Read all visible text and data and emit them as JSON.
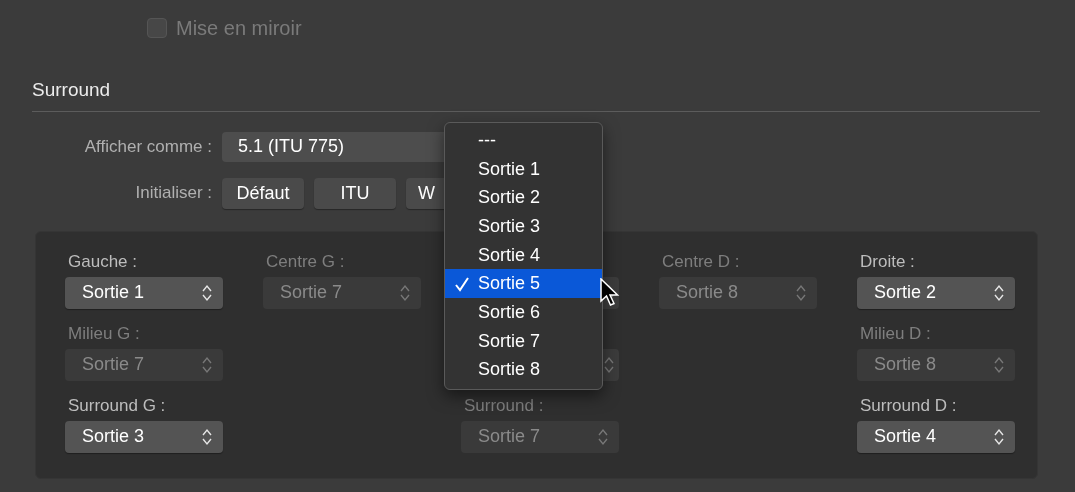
{
  "mirror": {
    "label": "Mise en miroir",
    "checked": false,
    "disabled": true
  },
  "section": {
    "title": "Surround"
  },
  "display_as": {
    "label": "Afficher comme :",
    "value": "5.1 (ITU 775)"
  },
  "reset": {
    "label": "Initialiser :",
    "buttons": [
      "Défaut",
      "ITU",
      "W"
    ]
  },
  "grid": {
    "rows": [
      [
        {
          "kind": "select",
          "label": "Gauche :",
          "value": "Sortie 1",
          "enabled": true
        },
        {
          "kind": "select",
          "label": "Centre G :",
          "value": "Sortie 7",
          "enabled": false
        },
        {
          "kind": "covered"
        },
        {
          "kind": "select",
          "label": "Centre D :",
          "value": "Sortie 8",
          "enabled": false
        },
        {
          "kind": "select",
          "label": "Droite :",
          "value": "Sortie 2",
          "enabled": true
        }
      ],
      [
        {
          "kind": "select",
          "label": "Milieu G :",
          "value": "Sortie 7",
          "enabled": false
        },
        {
          "kind": "empty"
        },
        {
          "kind": "covered"
        },
        {
          "kind": "empty"
        },
        {
          "kind": "select",
          "label": "Milieu D :",
          "value": "Sortie 8",
          "enabled": false
        }
      ],
      [
        {
          "kind": "select",
          "label": "Surround G :",
          "value": "Sortie 3",
          "enabled": true
        },
        {
          "kind": "empty"
        },
        {
          "kind": "select",
          "label": "Surround :",
          "value": "Sortie 7",
          "enabled": false
        },
        {
          "kind": "empty"
        },
        {
          "kind": "select",
          "label": "Surround D :",
          "value": "Sortie 4",
          "enabled": true
        }
      ]
    ]
  },
  "menu": {
    "items": [
      {
        "label": "---",
        "selected": false
      },
      {
        "label": "Sortie 1",
        "selected": false
      },
      {
        "label": "Sortie 2",
        "selected": false
      },
      {
        "label": "Sortie 3",
        "selected": false
      },
      {
        "label": "Sortie 4",
        "selected": false
      },
      {
        "label": "Sortie 5",
        "selected": true
      },
      {
        "label": "Sortie 6",
        "selected": false
      },
      {
        "label": "Sortie 7",
        "selected": false
      },
      {
        "label": "Sortie 8",
        "selected": false
      }
    ]
  }
}
